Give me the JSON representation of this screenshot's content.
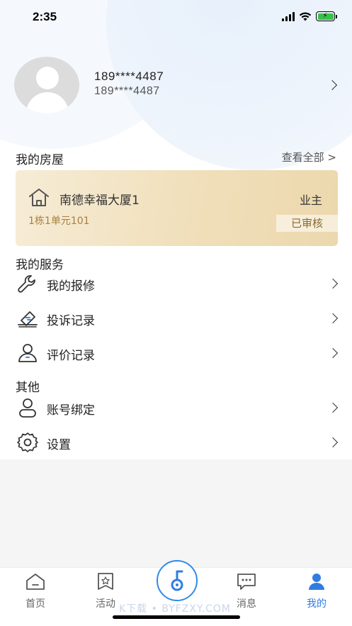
{
  "status_bar": {
    "time": "2:35"
  },
  "profile": {
    "name": "189****4487",
    "phone": "189****4487"
  },
  "my_house": {
    "title": "我的房屋",
    "view_all": "查看全部 >",
    "card": {
      "name": "南德幸福大厦1",
      "role": "业主",
      "unit": "1栋1单元101",
      "status": "已审核"
    }
  },
  "services": {
    "title": "我的服务",
    "items": [
      {
        "label": "我的报修",
        "icon": "wrench-icon"
      },
      {
        "label": "投诉记录",
        "icon": "complaint-icon"
      },
      {
        "label": "评价记录",
        "icon": "user-review-icon"
      }
    ]
  },
  "other": {
    "title": "其他",
    "items": [
      {
        "label": "账号绑定",
        "icon": "account-icon"
      },
      {
        "label": "设置",
        "icon": "gear-icon"
      }
    ]
  },
  "tabbar": {
    "items": [
      {
        "label": "首页",
        "icon": "home-icon"
      },
      {
        "label": "活动",
        "icon": "activity-icon"
      },
      {
        "label": "",
        "icon": "key-icon"
      },
      {
        "label": "消息",
        "icon": "message-icon"
      },
      {
        "label": "我的",
        "icon": "profile-icon"
      }
    ],
    "active": "我的",
    "accent": "#2f7de1"
  },
  "watermark": "K下载 • BYFZXY.COM"
}
